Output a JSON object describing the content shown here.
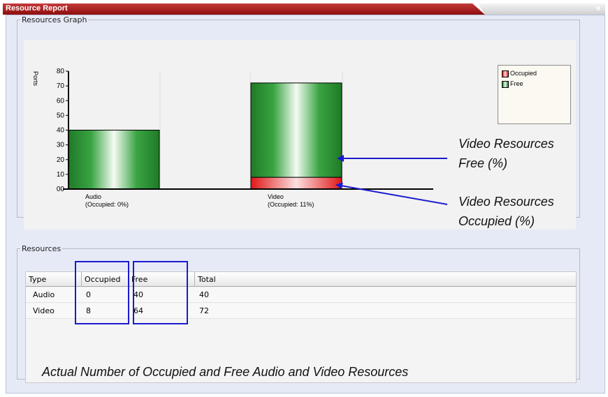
{
  "window": {
    "title": "Resource Report",
    "close_glyph": "×",
    "close_icon": "close-icon"
  },
  "graph": {
    "legend_title": "Resources Graph",
    "legend": [
      {
        "label": "Occupied",
        "color": "#e52a2a"
      },
      {
        "label": "Free",
        "color": "#2e9a3a"
      }
    ]
  },
  "chart_data": {
    "type": "bar",
    "stacked": true,
    "ylabel": "Ports",
    "ylim": [
      0,
      80
    ],
    "yticks": [
      "00",
      "10",
      "20",
      "30",
      "40",
      "50",
      "60",
      "70",
      "80"
    ],
    "categories": [
      {
        "name": "Audio",
        "note": "(Occupied: 0%)"
      },
      {
        "name": "Video",
        "note": "(Occupied: 11%)"
      }
    ],
    "series": [
      {
        "name": "Occupied",
        "values": [
          0,
          8
        ],
        "color": "#e52a2a"
      },
      {
        "name": "Free",
        "values": [
          40,
          64
        ],
        "color": "#2e9a3a"
      }
    ],
    "legend_position": "right",
    "grid": true
  },
  "resources": {
    "legend_title": "Resources",
    "columns": [
      "Type",
      "Occupied",
      "Free",
      "Total"
    ],
    "rows": [
      [
        "Audio",
        "0",
        "40",
        "40"
      ],
      [
        "Video",
        "8",
        "64",
        "72"
      ]
    ]
  },
  "callouts": {
    "video_free": [
      "Video Resources",
      "Free (%)"
    ],
    "video_occupied": [
      "Video Resources",
      "Occupied (%)"
    ],
    "actual_numbers": "Actual Number of Occupied and Free Audio and Video Resources",
    "color": "#1a1ad0"
  }
}
